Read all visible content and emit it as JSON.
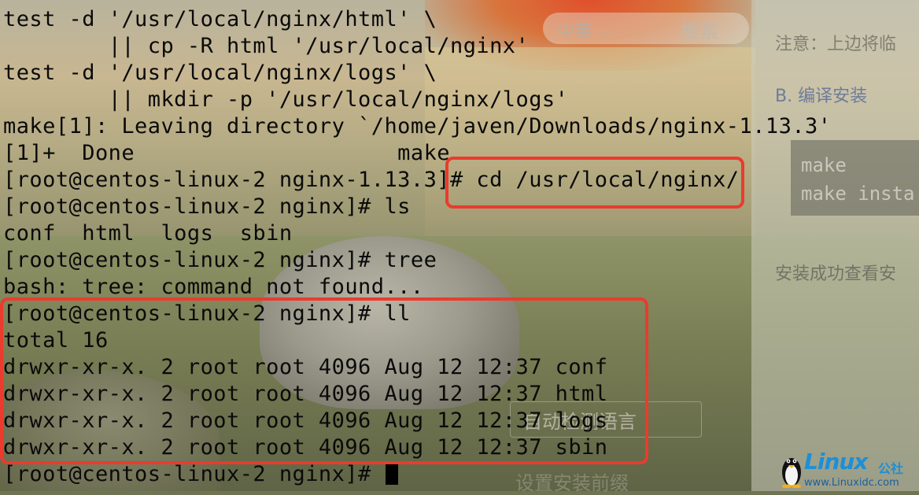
{
  "terminal": {
    "lines": [
      "test -d '/usr/local/nginx/html' \\",
      "        || cp -R html '/usr/local/nginx'",
      "test -d '/usr/local/nginx/logs' \\",
      "        || mkdir -p '/usr/local/nginx/logs'",
      "make[1]: Leaving directory `/home/javen/Downloads/nginx-1.13.3'",
      "[1]+  Done                    make",
      "[root@centos-linux-2 nginx-1.13.3]# cd /usr/local/nginx/",
      "[root@centos-linux-2 nginx]# ls",
      "conf  html  logs  sbin",
      "[root@centos-linux-2 nginx]# tree",
      "bash: tree: command not found...",
      "[root@centos-linux-2 nginx]# ll",
      "total 16",
      "drwxr-xr-x. 2 root root 4096 Aug 12 12:37 conf",
      "drwxr-xr-x. 2 root root 4096 Aug 12 12:37 html",
      "drwxr-xr-x. 2 root root 4096 Aug 12 12:37 logs",
      "drwxr-xr-x. 2 root root 4096 Aug 12 12:37 sbin"
    ],
    "prompt": "[root@centos-linux-2 nginx]# "
  },
  "background": {
    "search_lang": "中英 ⌵",
    "search_button": "搜索",
    "notice": "注意：上边将临",
    "section_b": "B. 编译安装",
    "code_make": "make",
    "code_make_install": "make insta",
    "success_heading": "安装成功查看安",
    "detect_language": "自动检测语言",
    "set_prefix": "设置安装前缀"
  },
  "watermark": {
    "brand": "Linux",
    "brand_cn": "公社",
    "site": "www.Linuxidc.com"
  },
  "colors": {
    "highlight": "#ea3b2e",
    "terminal_text": "#0a0a0a",
    "brand": "#1d8fd8"
  }
}
